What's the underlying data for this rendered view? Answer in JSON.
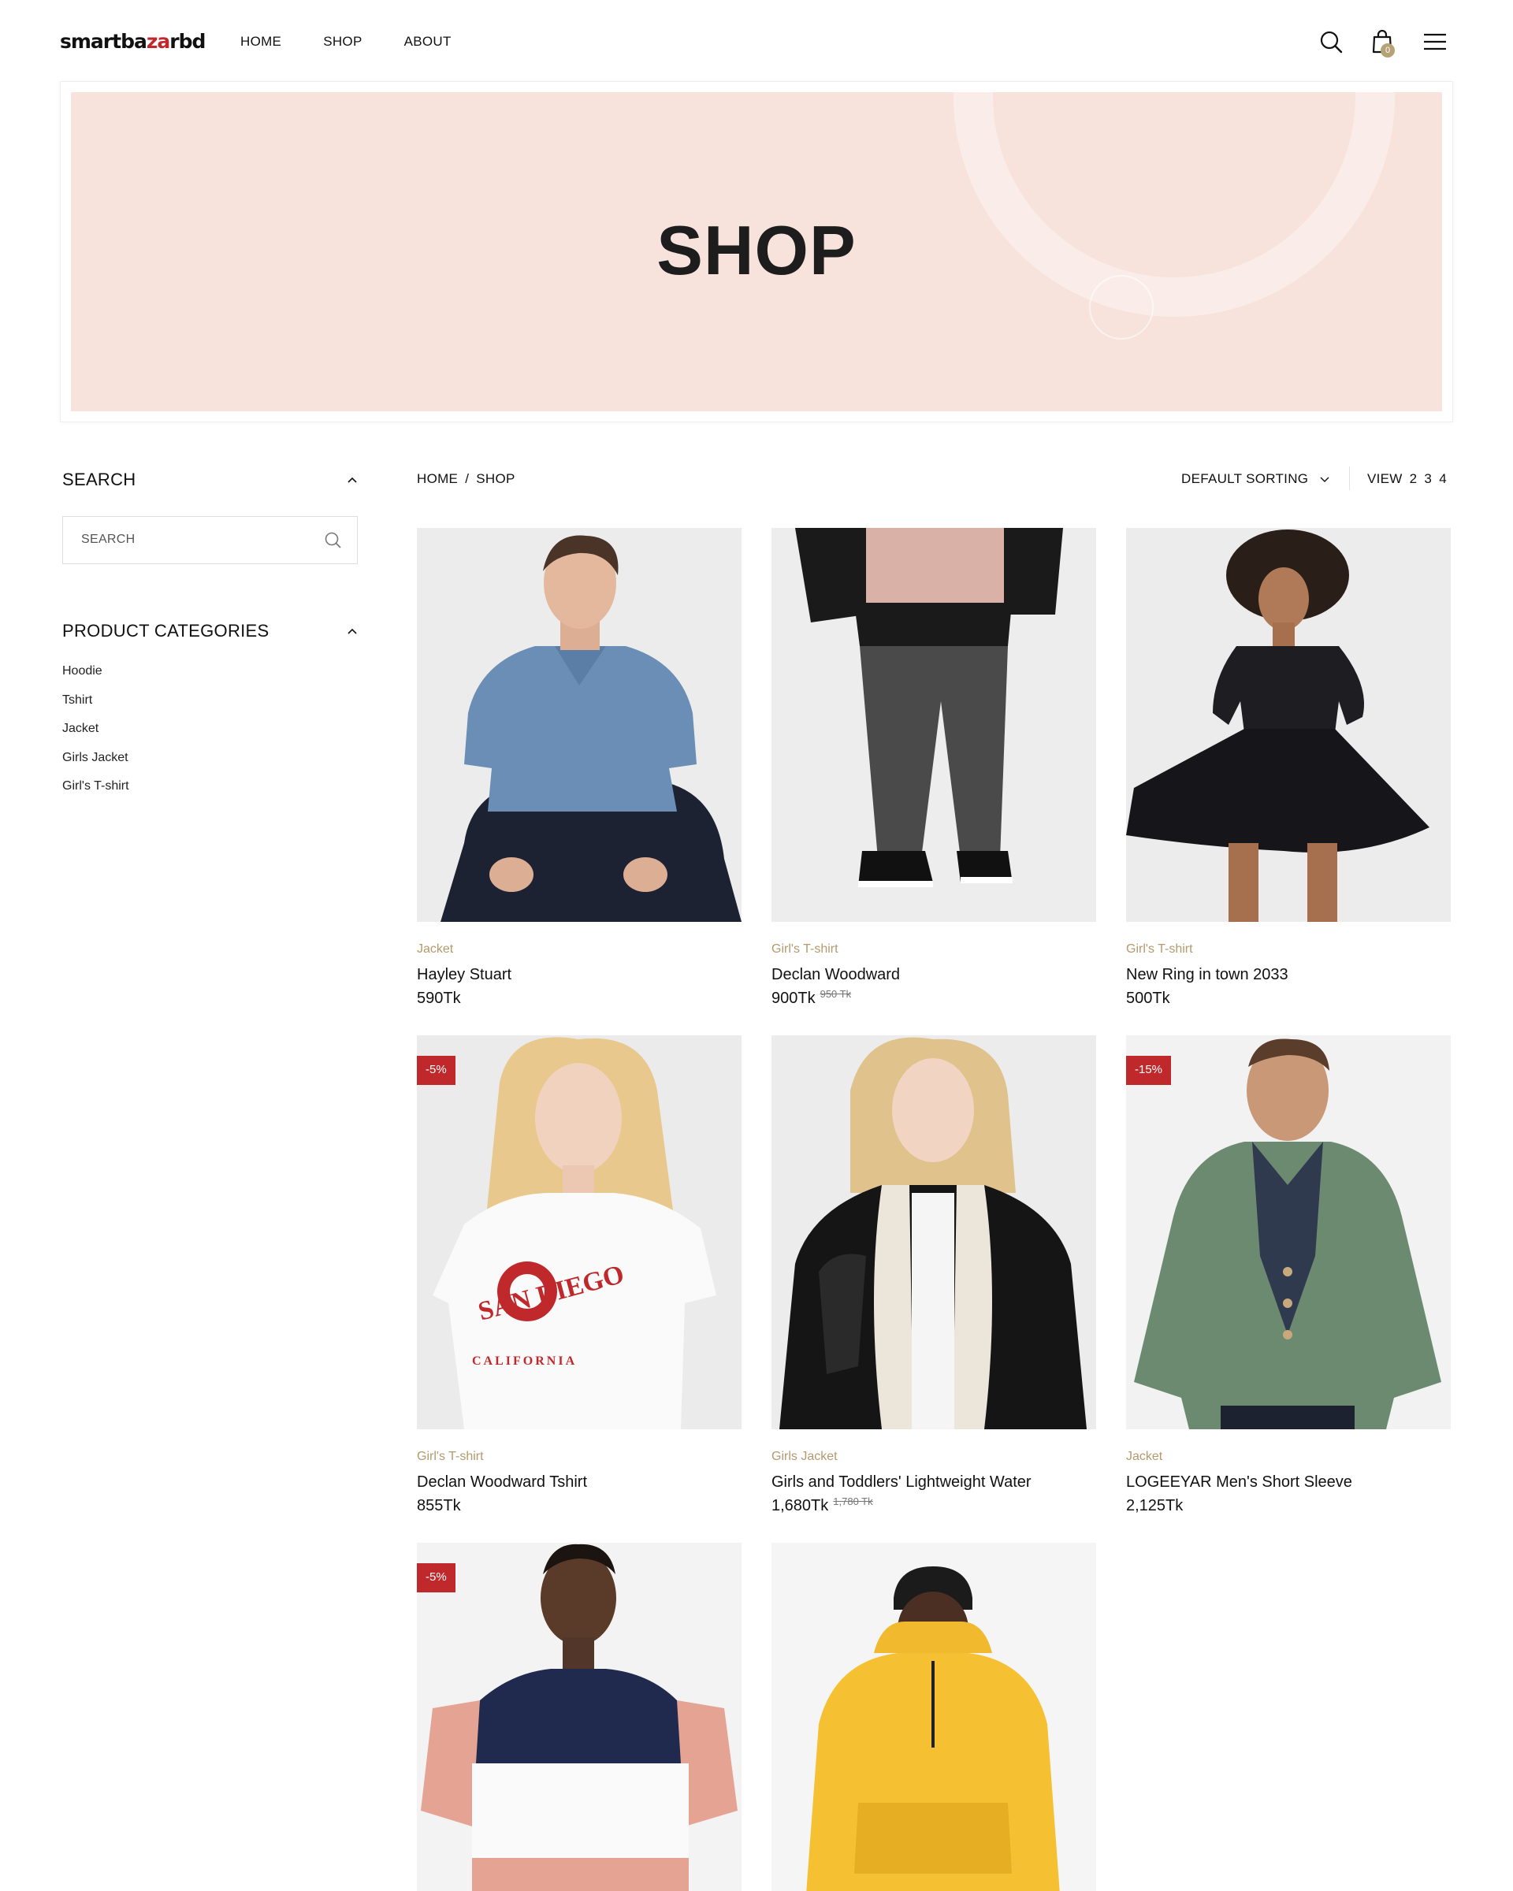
{
  "header": {
    "logo_part1": "smartba",
    "logo_accent": "za",
    "logo_part2": "rbd",
    "logo_accent_color": "#c0292b",
    "nav": [
      {
        "label": "HOME"
      },
      {
        "label": "SHOP"
      },
      {
        "label": "ABOUT"
      }
    ],
    "cart_count": "0",
    "icons": [
      "search-icon",
      "cart-icon",
      "menu-icon"
    ]
  },
  "hero": {
    "title": "SHOP",
    "background": "#f7e3dc"
  },
  "sidebar": {
    "search_title": "SEARCH",
    "search_placeholder": "SEARCH",
    "categories_title": "PRODUCT CATEGORIES",
    "categories": [
      {
        "label": "Hoodie"
      },
      {
        "label": "Tshirt"
      },
      {
        "label": "Jacket"
      },
      {
        "label": "Girls Jacket"
      },
      {
        "label": "Girl's T-shirt"
      }
    ]
  },
  "toolbar": {
    "breadcrumb_home": "HOME",
    "breadcrumb_sep": "/",
    "breadcrumb_current": "SHOP",
    "sorting": "DEFAULT SORTING",
    "view_label": "VIEW",
    "view_options": [
      "2",
      "3",
      "4"
    ]
  },
  "products": [
    {
      "category": "Jacket",
      "name": "Hayley Stuart",
      "price": "590Tk",
      "old_price": "",
      "badge": ""
    },
    {
      "category": "Girl's T-shirt",
      "name": "Declan Woodward",
      "price": "900Tk",
      "old_price": "950 Tk",
      "badge": ""
    },
    {
      "category": "Girl's T-shirt",
      "name": "New Ring in town 2033",
      "price": "500Tk",
      "old_price": "",
      "badge": ""
    },
    {
      "category": "Girl's T-shirt",
      "name": "Declan Woodward Tshirt",
      "price": "855Tk",
      "old_price": "",
      "badge": "-5%"
    },
    {
      "category": "Girls Jacket",
      "name": "Girls and Toddlers' Lightweight Water",
      "price": "1,680Tk",
      "old_price": "1,780 Tk",
      "badge": ""
    },
    {
      "category": "Jacket",
      "name": "LOGEEYAR Men's Short Sleeve",
      "price": "2,125Tk",
      "old_price": "",
      "badge": "-15%"
    },
    {
      "category": "",
      "name": "",
      "price": "",
      "old_price": "",
      "badge": "-5%"
    },
    {
      "category": "",
      "name": "",
      "price": "",
      "old_price": "",
      "badge": ""
    }
  ],
  "product_print_text": {
    "tee_line1": "SAN DIEGO",
    "tee_line2": "CALIFORNIA"
  }
}
